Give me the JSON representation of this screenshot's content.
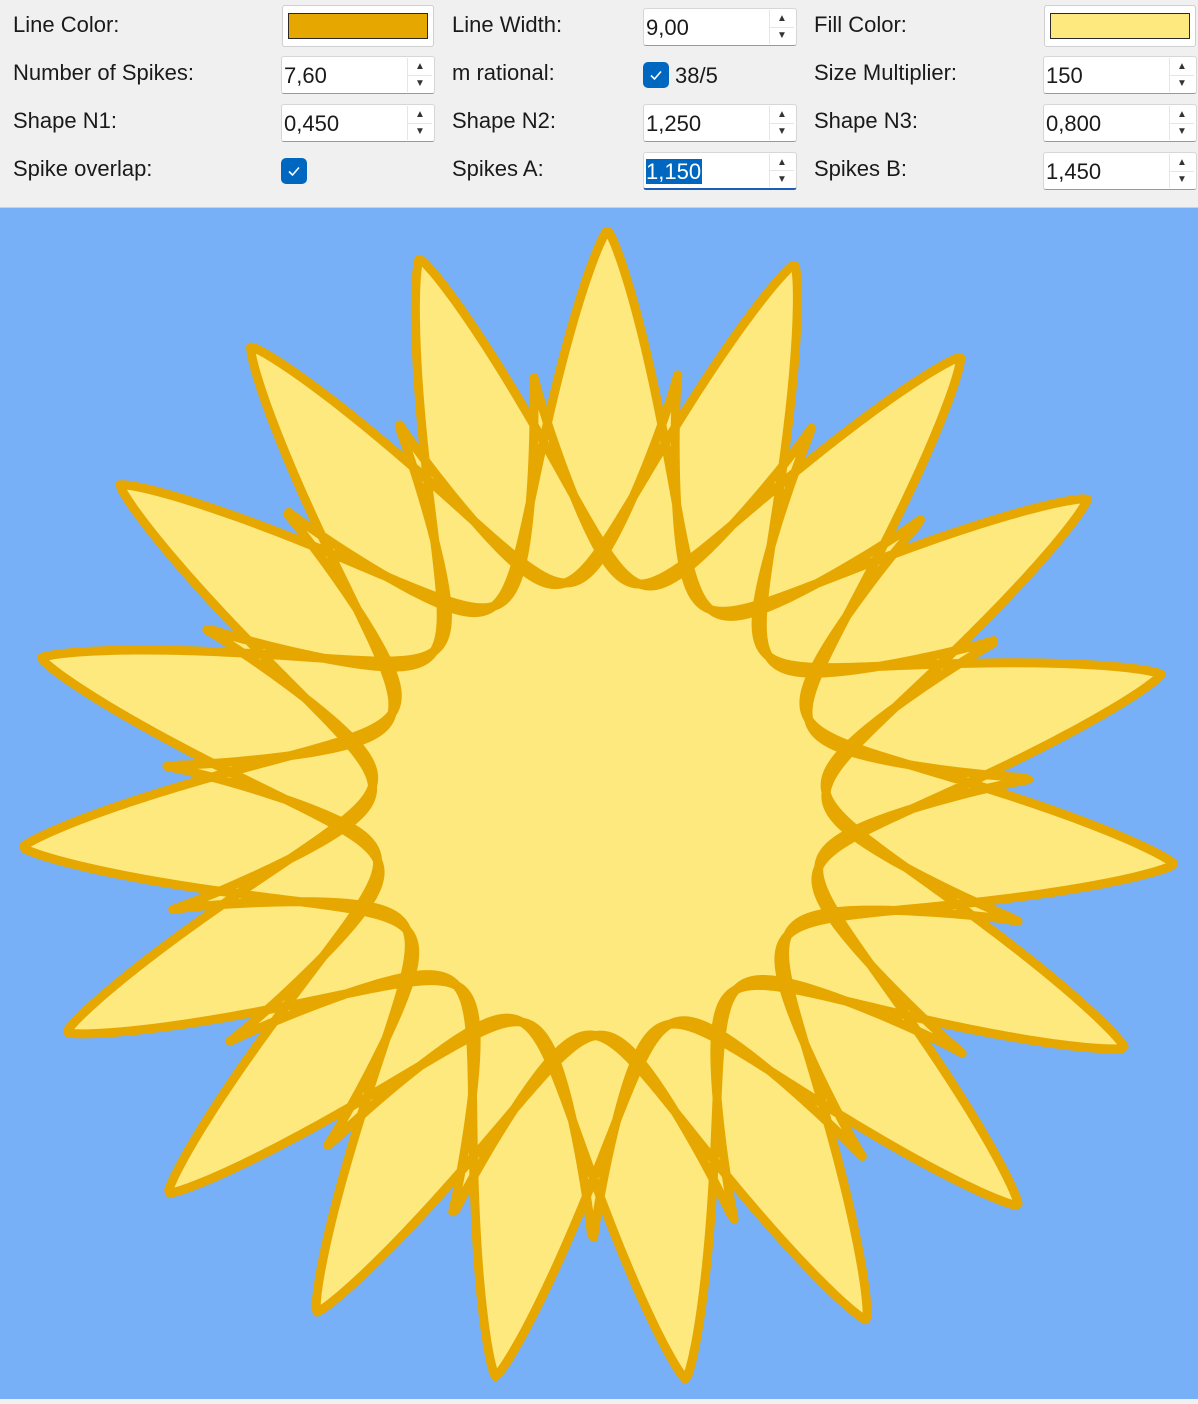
{
  "controls": {
    "line_color": {
      "label": "Line Color:",
      "color": "#e6a800"
    },
    "line_width": {
      "label": "Line Width:",
      "value": "9,00"
    },
    "fill_color": {
      "label": "Fill Color:",
      "color": "#fde97e"
    },
    "num_spikes": {
      "label": "Number of Spikes:",
      "value": "7,60"
    },
    "m_rational": {
      "label": "m rational:",
      "checked": true,
      "fraction": "38/5"
    },
    "size_multiplier": {
      "label": "Size Multiplier:",
      "value": "150"
    },
    "shape_n1": {
      "label": "Shape N1:",
      "value": "0,450"
    },
    "shape_n2": {
      "label": "Shape N2:",
      "value": "1,250"
    },
    "shape_n3": {
      "label": "Shape N3:",
      "value": "0,800"
    },
    "spike_overlap": {
      "label": "Spike overlap:",
      "checked": true
    },
    "spikes_a": {
      "label": "Spikes A:",
      "value": "1,150"
    },
    "spikes_b": {
      "label": "Spikes B:",
      "value": "1,450"
    }
  },
  "canvas": {
    "background": "#78b0f8",
    "stroke_color": "#e6a800",
    "fill_color": "#fde97e",
    "line_width": 9.0,
    "m": 7.6,
    "n1": 0.45,
    "n2": 1.25,
    "n3": 0.8,
    "a": 1.15,
    "b": 1.45,
    "size_multiplier": 150
  },
  "icons": {
    "spin_up": "▲",
    "spin_down": "▼"
  }
}
